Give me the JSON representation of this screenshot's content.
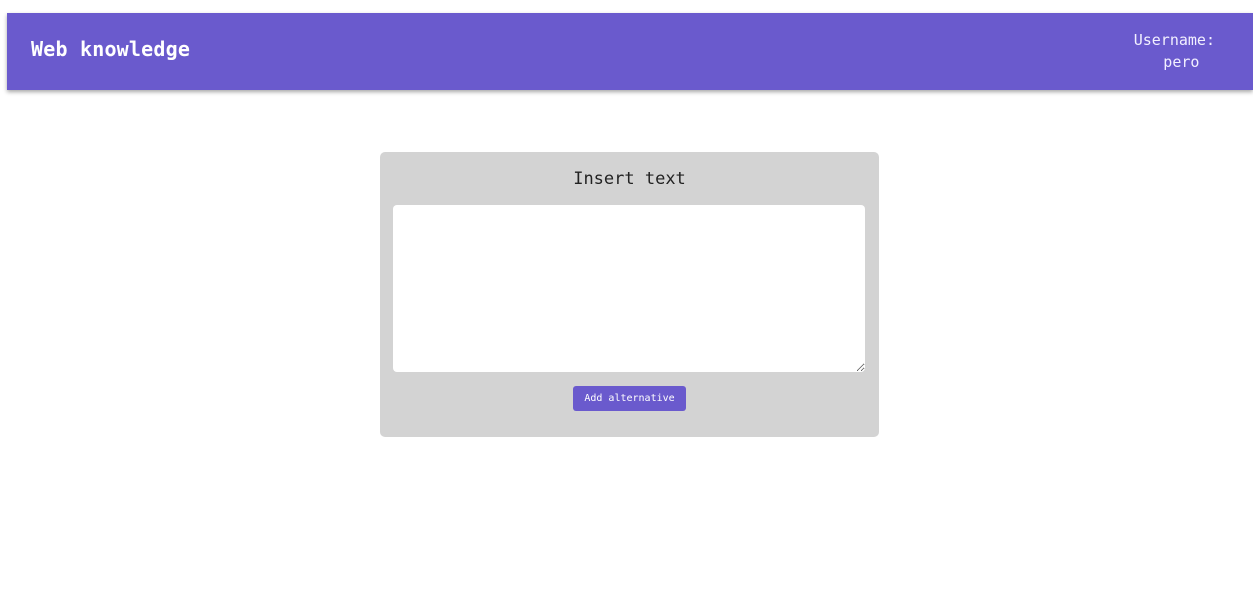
{
  "header": {
    "brand": "Web knowledge",
    "username_label": "Username:",
    "username_value": "pero"
  },
  "card": {
    "title": "Insert text",
    "textarea_value": "",
    "add_button_label": "Add alternative"
  },
  "colors": {
    "accent": "#6a5acd",
    "card_background": "#d3d3d3",
    "page_background": "#ffffff"
  }
}
